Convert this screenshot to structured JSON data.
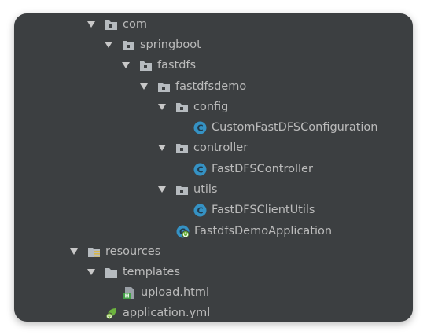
{
  "tree": {
    "pkg_com": "com",
    "pkg_springboot": "springboot",
    "pkg_fastdfs": "fastdfs",
    "pkg_fastdfsdemo": "fastdfsdemo",
    "pkg_config": "config",
    "class_custom_config": "CustomFastDFSConfiguration",
    "pkg_controller": "controller",
    "class_controller": "FastDFSController",
    "pkg_utils": "utils",
    "class_client_utils": "FastDFSClientUtils",
    "class_application": "FastdfsDemoApplication",
    "dir_resources": "resources",
    "dir_templates": "templates",
    "file_upload_html": "upload.html",
    "file_application_yml": "application.yml"
  },
  "icons": {
    "package": "package-folder-icon",
    "class": "java-class-icon",
    "spring_app": "spring-boot-application-icon",
    "resources": "resources-folder-icon",
    "html": "html-file-icon",
    "yml": "yml-config-icon"
  },
  "colors": {
    "panel_bg": "#3c3f41",
    "text": "#bbbbbb",
    "folder": "#b6bbbf",
    "class_icon": "#3592c4",
    "spring_green": "#6cb33e",
    "html_green": "#43a047"
  }
}
